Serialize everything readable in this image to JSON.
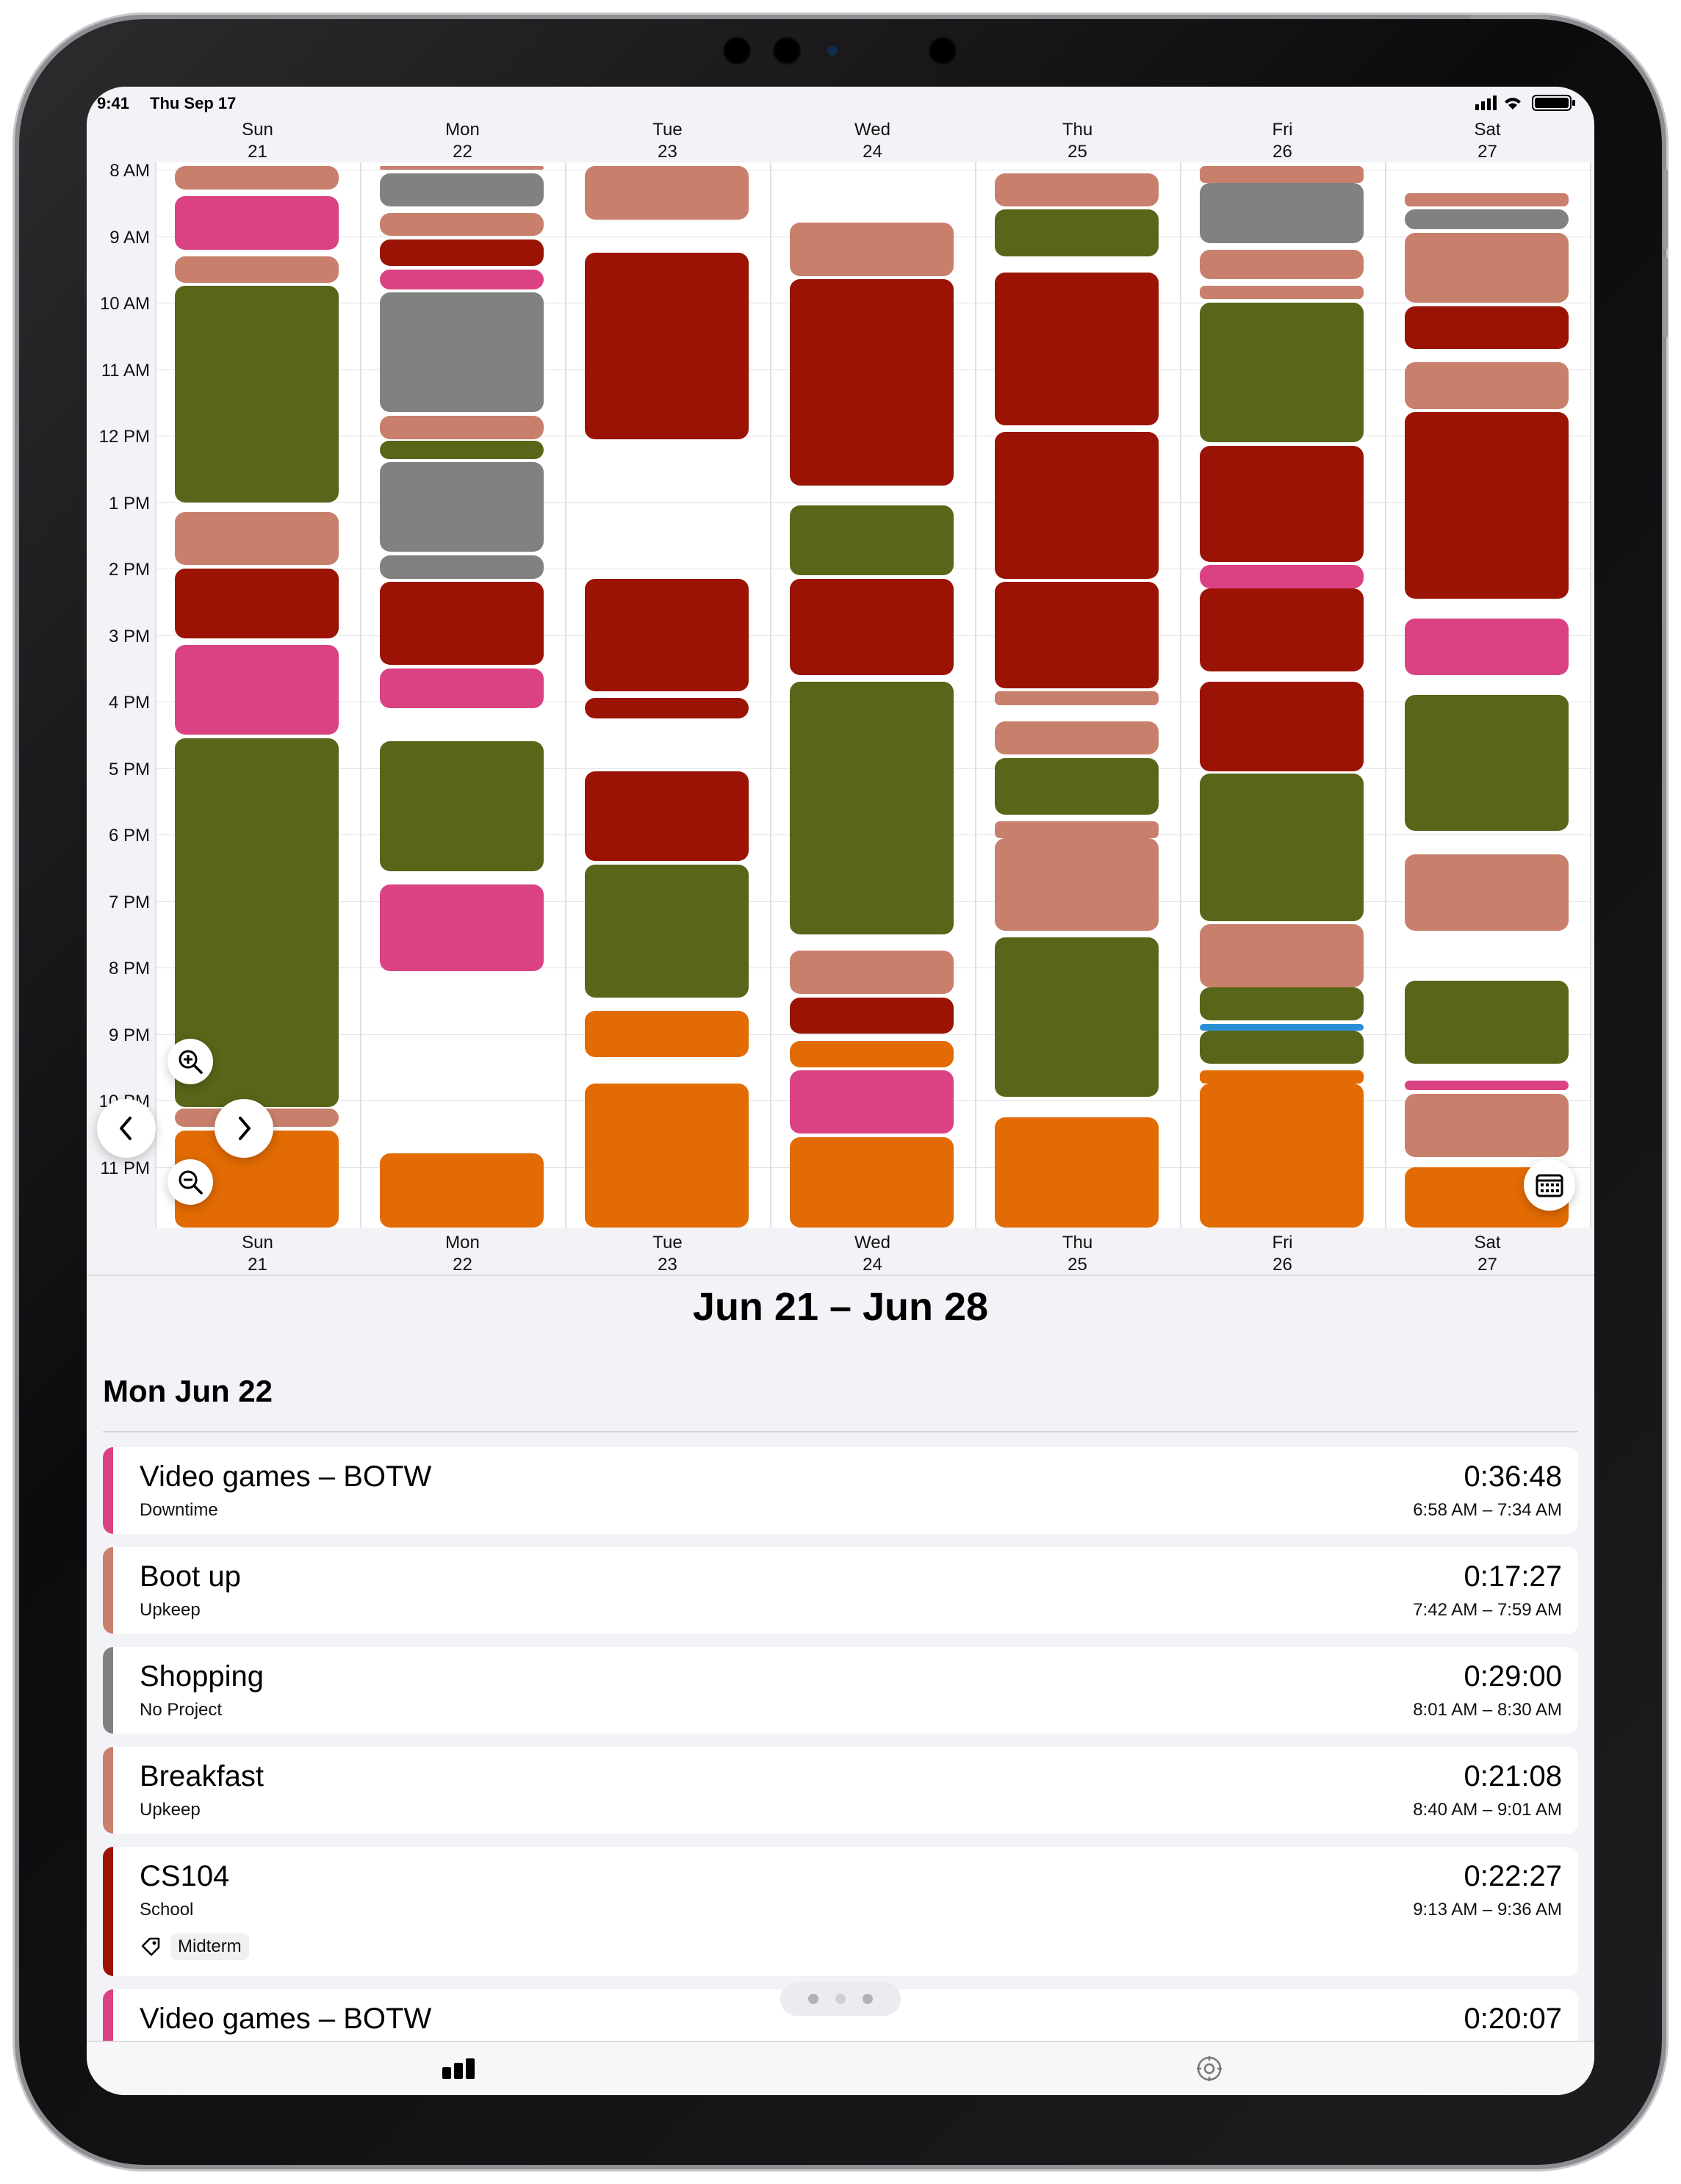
{
  "status": {
    "time": "9:41",
    "date": "Thu Sep 17"
  },
  "days": [
    {
      "name": "Sun",
      "num": "21"
    },
    {
      "name": "Mon",
      "num": "22"
    },
    {
      "name": "Tue",
      "num": "23"
    },
    {
      "name": "Wed",
      "num": "24"
    },
    {
      "name": "Thu",
      "num": "25"
    },
    {
      "name": "Fri",
      "num": "26"
    },
    {
      "name": "Sat",
      "num": "27"
    }
  ],
  "hours": [
    "8 AM",
    "9 AM",
    "10 AM",
    "11 AM",
    "12 PM",
    "1 PM",
    "2 PM",
    "3 PM",
    "4 PM",
    "5 PM",
    "6 PM",
    "7 PM",
    "8 PM",
    "9 PM",
    "10 PM",
    "11 PM"
  ],
  "colors": {
    "downtime": "#db4283",
    "upkeep": "#c8806d",
    "noproject": "#818181",
    "school": "#9a1304",
    "green": "#586619",
    "orange": "#e26b03",
    "blue": "#2a8fd6"
  },
  "events": [
    [
      [
        "upkeep",
        7.95,
        8.3
      ],
      [
        "downtime",
        8.4,
        9.2
      ],
      [
        "upkeep",
        9.3,
        9.7
      ],
      [
        "green",
        9.75,
        13.0
      ],
      [
        "upkeep",
        13.15,
        13.95
      ],
      [
        "school",
        14.0,
        15.05
      ],
      [
        "downtime",
        15.15,
        16.5
      ],
      [
        "green",
        16.55,
        22.1
      ],
      [
        "upkeep",
        22.12,
        22.4
      ],
      [
        "orange",
        22.45,
        24.0
      ]
    ],
    [
      [
        "upkeep",
        7.95,
        8.0
      ],
      [
        "noproject",
        8.05,
        8.55
      ],
      [
        "upkeep",
        8.65,
        9.0
      ],
      [
        "school",
        9.05,
        9.45
      ],
      [
        "downtime",
        9.5,
        9.8
      ],
      [
        "noproject",
        9.85,
        11.65
      ],
      [
        "upkeep",
        11.7,
        12.05
      ],
      [
        "green",
        12.08,
        12.35
      ],
      [
        "noproject",
        12.4,
        13.75
      ],
      [
        "noproject",
        13.8,
        14.15
      ],
      [
        "school",
        14.2,
        15.45
      ],
      [
        "downtime",
        15.5,
        16.1
      ],
      [
        "green",
        16.6,
        18.55
      ],
      [
        "downtime",
        18.75,
        20.05
      ],
      [
        "orange",
        22.8,
        24.0
      ]
    ],
    [
      [
        "upkeep",
        7.95,
        8.75
      ],
      [
        "school",
        9.25,
        12.05
      ],
      [
        "school",
        14.15,
        15.85
      ],
      [
        "school",
        15.95,
        16.25
      ],
      [
        "school",
        17.05,
        18.4
      ],
      [
        "green",
        18.45,
        20.45
      ],
      [
        "orange",
        20.65,
        21.35
      ],
      [
        "orange",
        21.75,
        24.0
      ]
    ],
    [
      [
        "upkeep",
        8.8,
        9.6
      ],
      [
        "school",
        9.65,
        12.75
      ],
      [
        "green",
        13.05,
        14.1
      ],
      [
        "school",
        14.15,
        15.6
      ],
      [
        "green",
        15.7,
        19.5
      ],
      [
        "upkeep",
        19.75,
        20.4
      ],
      [
        "school",
        20.45,
        21.0
      ],
      [
        "orange",
        21.1,
        21.5
      ],
      [
        "downtime",
        21.55,
        22.5
      ],
      [
        "orange",
        22.55,
        24.0
      ]
    ],
    [
      [
        "upkeep",
        8.05,
        8.55
      ],
      [
        "green",
        8.6,
        9.3
      ],
      [
        "school",
        9.55,
        11.85
      ],
      [
        "school",
        11.95,
        14.15
      ],
      [
        "school",
        14.2,
        15.8
      ],
      [
        "upkeep",
        15.85,
        16.05
      ],
      [
        "upkeep",
        16.3,
        16.8
      ],
      [
        "green",
        16.85,
        17.7
      ],
      [
        "upkeep",
        17.8,
        18.05
      ],
      [
        "upkeep",
        18.05,
        19.45
      ],
      [
        "green",
        19.55,
        21.95
      ],
      [
        "orange",
        22.25,
        24.0
      ]
    ],
    [
      [
        "upkeep",
        7.95,
        8.2
      ],
      [
        "noproject",
        8.2,
        9.1
      ],
      [
        "upkeep",
        9.2,
        9.65
      ],
      [
        "upkeep",
        9.75,
        9.95
      ],
      [
        "green",
        10.0,
        12.1
      ],
      [
        "school",
        12.15,
        13.9
      ],
      [
        "downtime",
        13.95,
        14.3
      ],
      [
        "school",
        14.3,
        15.55
      ],
      [
        "school",
        15.7,
        17.05
      ],
      [
        "green",
        17.08,
        19.3
      ],
      [
        "upkeep",
        19.35,
        20.3
      ],
      [
        "green",
        20.3,
        20.8
      ],
      [
        "blue",
        20.85,
        20.95
      ],
      [
        "green",
        20.95,
        21.45
      ],
      [
        "orange",
        21.55,
        21.75
      ],
      [
        "orange",
        21.75,
        24.0
      ]
    ],
    [
      [
        "upkeep",
        8.35,
        8.55
      ],
      [
        "noproject",
        8.6,
        8.9
      ],
      [
        "upkeep",
        8.95,
        10.0
      ],
      [
        "school",
        10.05,
        10.7
      ],
      [
        "upkeep",
        10.9,
        11.6
      ],
      [
        "school",
        11.65,
        14.45
      ],
      [
        "downtime",
        14.75,
        15.6
      ],
      [
        "green",
        15.9,
        17.95
      ],
      [
        "upkeep",
        18.3,
        19.45
      ],
      [
        "green",
        20.2,
        21.45
      ],
      [
        "downtime",
        21.7,
        21.85
      ],
      [
        "upkeep",
        21.9,
        22.85
      ],
      [
        "orange",
        23.0,
        24.0
      ]
    ]
  ],
  "range_title": "Jun 21 – Jun 28",
  "day_title": "Mon Jun 22",
  "entries": [
    {
      "title": "Video games – BOTW",
      "project": "Downtime",
      "duration": "0:36:48",
      "time": "6:58 AM – 7:34 AM",
      "color": "#db4283"
    },
    {
      "title": "Boot up",
      "project": "Upkeep",
      "duration": "0:17:27",
      "time": "7:42 AM – 7:59 AM",
      "color": "#c8806d"
    },
    {
      "title": "Shopping",
      "project": "No Project",
      "duration": "0:29:00",
      "time": "8:01 AM – 8:30 AM",
      "color": "#818181"
    },
    {
      "title": "Breakfast",
      "project": "Upkeep",
      "duration": "0:21:08",
      "time": "8:40 AM – 9:01 AM",
      "color": "#c8806d"
    },
    {
      "title": "CS104",
      "project": "School",
      "duration": "0:22:27",
      "time": "9:13 AM – 9:36 AM",
      "color": "#9a1304",
      "tag": "Midterm"
    },
    {
      "title": "Video games – BOTW",
      "project": "",
      "duration": "0:20:07",
      "time": "",
      "color": "#db4283"
    }
  ],
  "icons": {
    "zoom_in": "zoom-in-icon",
    "zoom_out": "zoom-out-icon",
    "prev": "chevron-left-icon",
    "next": "chevron-right-icon",
    "calendar": "calendar-icon",
    "chart_tab": "bar-chart-icon",
    "settings_tab": "settings-icon",
    "tag": "tag-icon"
  }
}
